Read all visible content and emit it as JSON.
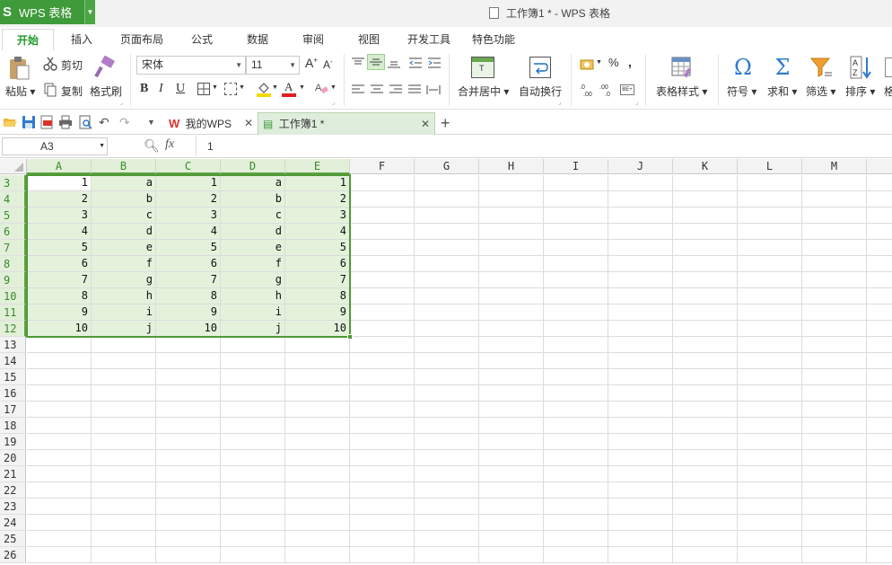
{
  "app": {
    "logo": "S",
    "name": "WPS 表格",
    "window_title": "工作簿1 * - WPS 表格"
  },
  "menu_tabs": [
    "开始",
    "插入",
    "页面布局",
    "公式",
    "数据",
    "审阅",
    "视图",
    "开发工具",
    "特色功能"
  ],
  "active_tab": "开始",
  "ribbon": {
    "paste": "粘贴",
    "cut": "剪切",
    "copy": "复制",
    "format_painter": "格式刷",
    "font_name": "宋体",
    "font_size": "11",
    "grow_font": "A",
    "shrink_font": "A",
    "bold": "B",
    "italic": "I",
    "underline": "U",
    "merge_center": "合并居中",
    "wrap_text": "自动换行",
    "percent": "%",
    "thousands": ",",
    "table_style": "表格样式",
    "symbol": "符号",
    "sum": "求和",
    "filter": "筛选",
    "sort": "排序",
    "more": "格"
  },
  "doc_tabs": [
    {
      "label": "我的WPS",
      "icon": "wps-logo-icon"
    },
    {
      "label": "工作簿1 *",
      "icon": "spreadsheet-icon"
    }
  ],
  "formula_bar": {
    "name_box": "A3",
    "fx": "fx",
    "value": "1"
  },
  "sheet": {
    "columns": [
      "A",
      "B",
      "C",
      "D",
      "E",
      "F",
      "G",
      "H",
      "I",
      "J",
      "K",
      "L",
      "M"
    ],
    "rows": [
      3,
      4,
      5,
      6,
      7,
      8,
      9,
      10,
      11,
      12,
      13,
      14,
      15,
      16,
      17,
      18,
      19,
      20,
      21,
      22,
      23,
      24,
      25,
      26
    ],
    "selected_columns": [
      "A",
      "B",
      "C",
      "D",
      "E"
    ],
    "selected_rows": [
      3,
      4,
      5,
      6,
      7,
      8,
      9,
      10,
      11,
      12
    ],
    "data": [
      [
        "1",
        "a",
        "1",
        "a",
        "1"
      ],
      [
        "2",
        "b",
        "2",
        "b",
        "2"
      ],
      [
        "3",
        "c",
        "3",
        "c",
        "3"
      ],
      [
        "4",
        "d",
        "4",
        "d",
        "4"
      ],
      [
        "5",
        "e",
        "5",
        "e",
        "5"
      ],
      [
        "6",
        "f",
        "6",
        "f",
        "6"
      ],
      [
        "7",
        "g",
        "7",
        "g",
        "7"
      ],
      [
        "8",
        "h",
        "8",
        "h",
        "8"
      ],
      [
        "9",
        "i",
        "9",
        "i",
        "9"
      ],
      [
        "10",
        "j",
        "10",
        "j",
        "10"
      ]
    ]
  },
  "colors": {
    "accent": "#3f9a3a",
    "selection_fill": "#e4f2dc",
    "selection_border": "#4e9a35"
  }
}
